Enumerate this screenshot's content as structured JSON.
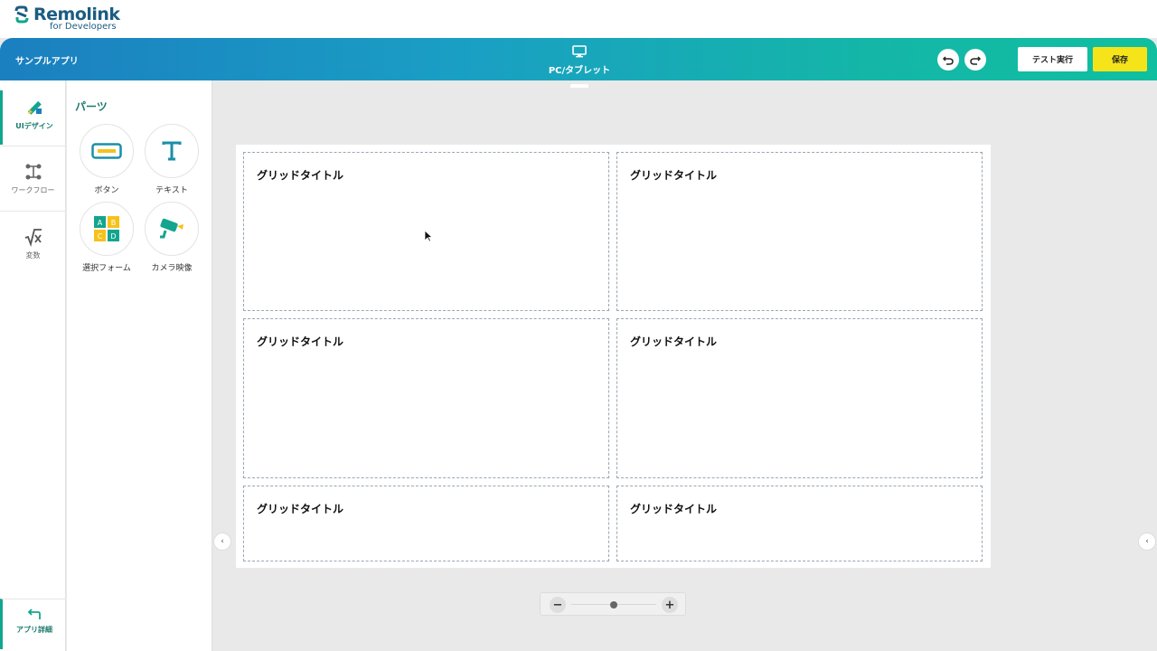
{
  "brand": {
    "name": "Remolink",
    "sub": "for Developers"
  },
  "header": {
    "app_name": "サンプルアプリ",
    "device_tab": "PC/タブレット",
    "test_label": "テスト実行",
    "save_label": "保存"
  },
  "rail": {
    "ui_design": "UIデザイン",
    "workflow": "ワークフロー",
    "variables": "変数",
    "app_details": "アプリ詳細"
  },
  "panel": {
    "title": "パーツ",
    "parts": [
      {
        "label": "ボタン",
        "icon": "button-icon"
      },
      {
        "label": "テキスト",
        "icon": "text-icon"
      },
      {
        "label": "選択フォーム",
        "icon": "choice-form-icon"
      },
      {
        "label": "カメラ映像",
        "icon": "camera-icon"
      }
    ],
    "choice_letters": [
      "A",
      "B",
      "C",
      "D"
    ]
  },
  "grid": {
    "cells": [
      {
        "title": "グリッドタイトル"
      },
      {
        "title": "グリッドタイトル"
      },
      {
        "title": "グリッドタイトル"
      },
      {
        "title": "グリッドタイトル"
      },
      {
        "title": "グリッドタイトル"
      },
      {
        "title": "グリッドタイトル"
      }
    ]
  },
  "zoom": {
    "minus": "−",
    "plus": "+"
  },
  "colors": {
    "accent": "#13a58e",
    "header_start": "#1b7fc0",
    "header_end": "#10bfa0",
    "save": "#f6e41a",
    "brand": "#1b5c83"
  }
}
